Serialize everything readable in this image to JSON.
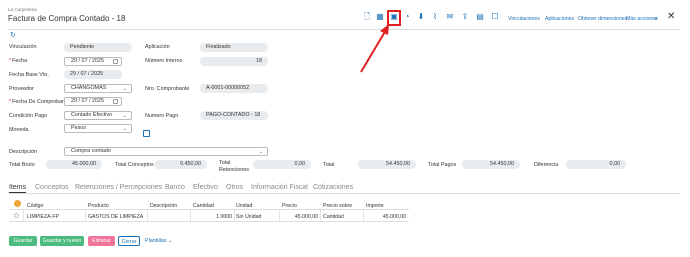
{
  "header": {
    "company": "La Carpinteria",
    "title": "Factura de Compra Contado - 18",
    "links": [
      "Vinculaciones",
      "Aplicaciones",
      "Obtener dimensiones",
      "Más acciones"
    ],
    "more_caret": "∨",
    "refresh_glyph": "↻"
  },
  "form": {
    "vinculacion": {
      "label": "Vinculación",
      "value": "Pendiente"
    },
    "aplicacion": {
      "label": "Aplicación",
      "value": "Finalizado"
    },
    "fecha": {
      "label": "Fecha",
      "value": "29 / 07 / 2025"
    },
    "numero_interno": {
      "label": "Número Interno",
      "value": "18"
    },
    "fecha_base_vto": {
      "label": "Fecha Base Vto.",
      "value": "29 / 07 / 2025"
    },
    "proveedor": {
      "label": "Proveedor",
      "value": "CHANGOMAS"
    },
    "nro_comprobante": {
      "label": "Nro. Comprobante",
      "value": "A-0001-00000052"
    },
    "fecha_comprobante": {
      "label": "Fecha De Comprobante",
      "value": "29 / 07 / 2025"
    },
    "condicion_pago": {
      "label": "Condición Pago",
      "value": "Contado Efectivo"
    },
    "numero_pago": {
      "label": "Numero Pago",
      "value": "PAGO-CONTADO - 18"
    },
    "moneda": {
      "label": "Moneda",
      "value": "Pesos"
    },
    "descripcion": {
      "label": "Descripción",
      "value": "Compra contado"
    }
  },
  "totals": {
    "bruto": {
      "label": "Total Bruto",
      "value": "45.000,00"
    },
    "conceptos": {
      "label": "Total Conceptos",
      "value": "9.450,00"
    },
    "retenciones": {
      "label1": "Total",
      "label2": "Retenciones",
      "value": "0,00"
    },
    "total": {
      "label": "Total",
      "value": "54.450,00"
    },
    "pagos": {
      "label": "Total Pagos",
      "value": "54.450,00"
    },
    "diferencia": {
      "label": "Diferencia",
      "value": "0,00"
    }
  },
  "tabs": [
    "Items",
    "Conceptos",
    "Retenciones / Percepciones",
    "Banco",
    "Efectivo",
    "Otros",
    "Información Fiscal",
    "Cotizaciones"
  ],
  "table": {
    "headers": [
      "Código",
      "Producto",
      "Descripción",
      "Cantidad",
      "Unidad",
      "Precio",
      "Precio sobre",
      "Importe"
    ],
    "rows": [
      [
        "LIMPIEZA-FP",
        "GASTOS DE LIMPIEZA",
        "",
        "1.0000",
        "Sin Unidad",
        "45.000,00",
        "Cantidad",
        "45.000,00"
      ]
    ]
  },
  "buttons": {
    "guardar": "Guardar",
    "guardar_nuevo": "Guardar y nuevo",
    "eliminar": "Eliminar",
    "cerrar": "Cerrar",
    "plantillas": "Plantillas"
  },
  "colors": {
    "accent": "#1a6fb5",
    "green": "#4cbb7f",
    "pink": "#f0749a",
    "annotation": "#e02020"
  }
}
